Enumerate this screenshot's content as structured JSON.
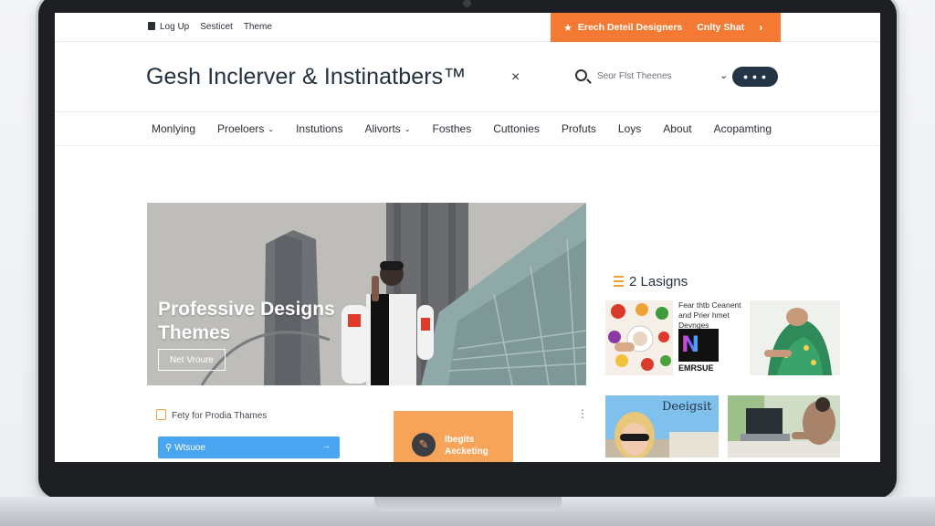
{
  "topbar": {
    "links": [
      "Log Up",
      "Sesticet",
      "Theme"
    ],
    "promo_text": "Erech Deteil Designers",
    "promo_cta": "Cnlty Shat",
    "promo_chevron": "›"
  },
  "header": {
    "brand": "Gesh Inclerver & Instinatbers™",
    "close_symbol": "×",
    "search_placeholder": "Seor Flst Theenes",
    "search_dropdown": "⌄",
    "search_button": "● ● ●"
  },
  "nav": {
    "items": [
      {
        "label": "Monlying",
        "dropdown": false
      },
      {
        "label": "Proeloers",
        "dropdown": true
      },
      {
        "label": "Instutions",
        "dropdown": false
      },
      {
        "label": "Alivorts",
        "dropdown": true
      },
      {
        "label": "Fosthes",
        "dropdown": false
      },
      {
        "label": "Cuttonies",
        "dropdown": false
      },
      {
        "label": "Profuts",
        "dropdown": false
      },
      {
        "label": "Loys",
        "dropdown": false
      },
      {
        "label": "About",
        "dropdown": false
      },
      {
        "label": "Acopamting",
        "dropdown": false
      }
    ],
    "caret": "⌄"
  },
  "hero": {
    "title": "Professive Designs Themes",
    "button": "Net Vroure"
  },
  "feature": {
    "label": "Fety for Prodia Thames",
    "input_value": "Wtsuoe",
    "input_arrow": "→",
    "kebab": "⋮",
    "card_title_line1": "Ibegits",
    "card_title_line2": "Aecketing"
  },
  "sidebar": {
    "title": "2 Lasigns",
    "tile2_text": "Fear thtb Ceanent and Prier hmet Devnges",
    "tile2_brand": "EMRSUE",
    "tile2_logo": "N",
    "tile4_caption": "Deeigsit"
  },
  "colors": {
    "promo": "#f47a33",
    "brand_text": "#233140",
    "search_button": "#243447",
    "blue_input": "#4aa5f0",
    "orange_card": "#f5a459"
  }
}
